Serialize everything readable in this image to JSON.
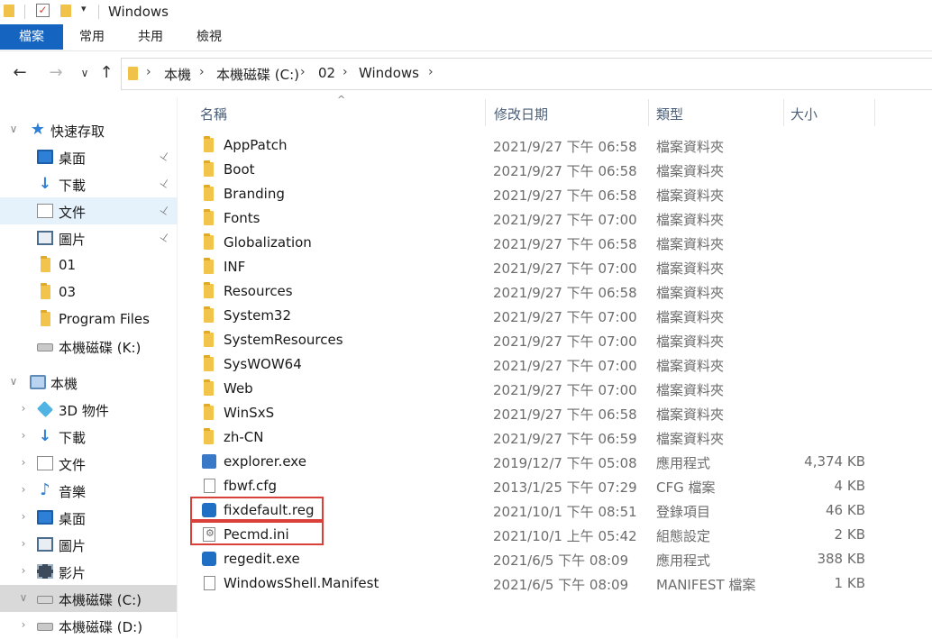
{
  "window": {
    "title": "Windows"
  },
  "ribbon": {
    "tabs": [
      "檔案",
      "常用",
      "共用",
      "檢視"
    ]
  },
  "breadcrumb": [
    "本機",
    "本機磁碟 (C:)",
    "02",
    "Windows"
  ],
  "columns": {
    "name": "名稱",
    "date": "修改日期",
    "type": "類型",
    "size": "大小"
  },
  "sidebar": {
    "items": [
      {
        "label": "快速存取",
        "icon": "star-icon",
        "state": ""
      },
      {
        "label": "桌面",
        "icon": "desktop-icon",
        "state": "",
        "pinned": true
      },
      {
        "label": "下載",
        "icon": "download-icon",
        "state": "",
        "pinned": true
      },
      {
        "label": "文件",
        "icon": "document-icon",
        "state": "hover",
        "pinned": true
      },
      {
        "label": "圖片",
        "icon": "pictures-icon",
        "state": "",
        "pinned": true
      },
      {
        "label": "01",
        "icon": "folder-icon",
        "state": ""
      },
      {
        "label": "03",
        "icon": "folder-icon",
        "state": ""
      },
      {
        "label": "Program Files",
        "icon": "folder-icon",
        "state": ""
      },
      {
        "label": "本機磁碟 (K:)",
        "icon": "drive-icon",
        "state": ""
      },
      {
        "label": "本機",
        "icon": "this-pc-icon",
        "state": ""
      },
      {
        "label": "3D 物件",
        "icon": "3d-objects-icon",
        "state": ""
      },
      {
        "label": "下載",
        "icon": "download-icon",
        "state": ""
      },
      {
        "label": "文件",
        "icon": "document-icon",
        "state": ""
      },
      {
        "label": "音樂",
        "icon": "music-icon",
        "state": ""
      },
      {
        "label": "桌面",
        "icon": "desktop-icon",
        "state": ""
      },
      {
        "label": "圖片",
        "icon": "pictures-icon",
        "state": ""
      },
      {
        "label": "影片",
        "icon": "videos-icon",
        "state": ""
      },
      {
        "label": "本機磁碟 (C:)",
        "icon": "c-drive-icon",
        "state": "current"
      },
      {
        "label": "本機磁碟 (D:)",
        "icon": "drive-icon",
        "state": ""
      }
    ]
  },
  "files": [
    {
      "name": "AppPatch",
      "date": "2021/9/27 下午 06:58",
      "type": "檔案資料夾",
      "size": "",
      "icon": "folder-icon"
    },
    {
      "name": "Boot",
      "date": "2021/9/27 下午 06:58",
      "type": "檔案資料夾",
      "size": "",
      "icon": "folder-icon"
    },
    {
      "name": "Branding",
      "date": "2021/9/27 下午 06:58",
      "type": "檔案資料夾",
      "size": "",
      "icon": "folder-icon"
    },
    {
      "name": "Fonts",
      "date": "2021/9/27 下午 07:00",
      "type": "檔案資料夾",
      "size": "",
      "icon": "folder-icon"
    },
    {
      "name": "Globalization",
      "date": "2021/9/27 下午 06:58",
      "type": "檔案資料夾",
      "size": "",
      "icon": "folder-icon"
    },
    {
      "name": "INF",
      "date": "2021/9/27 下午 07:00",
      "type": "檔案資料夾",
      "size": "",
      "icon": "folder-icon"
    },
    {
      "name": "Resources",
      "date": "2021/9/27 下午 06:58",
      "type": "檔案資料夾",
      "size": "",
      "icon": "folder-icon"
    },
    {
      "name": "System32",
      "date": "2021/9/27 下午 07:00",
      "type": "檔案資料夾",
      "size": "",
      "icon": "folder-icon"
    },
    {
      "name": "SystemResources",
      "date": "2021/9/27 下午 07:00",
      "type": "檔案資料夾",
      "size": "",
      "icon": "folder-icon"
    },
    {
      "name": "SysWOW64",
      "date": "2021/9/27 下午 07:00",
      "type": "檔案資料夾",
      "size": "",
      "icon": "folder-icon"
    },
    {
      "name": "Web",
      "date": "2021/9/27 下午 07:00",
      "type": "檔案資料夾",
      "size": "",
      "icon": "folder-icon"
    },
    {
      "name": "WinSxS",
      "date": "2021/9/27 下午 06:58",
      "type": "檔案資料夾",
      "size": "",
      "icon": "folder-icon"
    },
    {
      "name": "zh-CN",
      "date": "2021/9/27 下午 06:59",
      "type": "檔案資料夾",
      "size": "",
      "icon": "folder-icon"
    },
    {
      "name": "explorer.exe",
      "date": "2019/12/7 下午 05:08",
      "type": "應用程式",
      "size": "4,374 KB",
      "icon": "exe-icon"
    },
    {
      "name": "fbwf.cfg",
      "date": "2013/1/25 下午 07:29",
      "type": "CFG 檔案",
      "size": "4 KB",
      "icon": "file-icon"
    },
    {
      "name": "fixdefault.reg",
      "date": "2021/10/1 下午 08:51",
      "type": "登錄項目",
      "size": "46 KB",
      "icon": "registry-icon",
      "highlighted": true
    },
    {
      "name": "Pecmd.ini",
      "date": "2021/10/1 上午 05:42",
      "type": "組態設定",
      "size": "2 KB",
      "icon": "settings-file-icon",
      "highlighted": true
    },
    {
      "name": "regedit.exe",
      "date": "2021/6/5 下午 08:09",
      "type": "應用程式",
      "size": "388 KB",
      "icon": "registry-icon"
    },
    {
      "name": "WindowsShell.Manifest",
      "date": "2021/6/5 下午 08:09",
      "type": "MANIFEST 檔案",
      "size": "1 KB",
      "icon": "file-icon"
    }
  ],
  "colors": {
    "accent": "#1565c0",
    "highlight_box": "#d9403a",
    "selection": "#cde6f7",
    "folder": "#f3c44c"
  }
}
